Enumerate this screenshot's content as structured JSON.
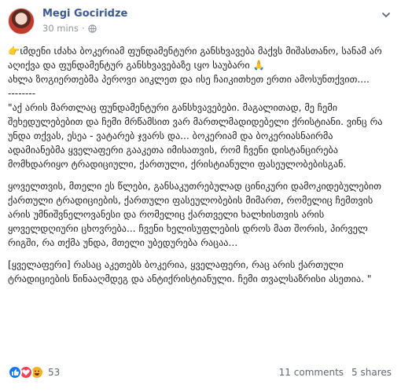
{
  "post": {
    "author": "Megi Gociridze",
    "time": "30 mins",
    "paragraphs": [
      "ιმდენი ιძახა ბოკერიამ ფუნდამენტური განსხვავება მაქვს მიშასთანო, სანამ არ აღიქვა და ფუნდამენტურ განსხვავებაზე ιყო საუბარი",
      "ახლა ზოგიერთებმა პეროვი აიკლეთ და ისე ჩაიკითხეთ ერთი ამოსუნთქვით....",
      "--------",
      "\"აქ არის მართლაც ფუნდამენტური განსხვავებები. მაგალითად, მე ჩემი შეხედულებებით და ჩემი მრწამსით ვარ მართლმადიდებელი ქრისტიანი. ვინც რა უნდა თქვას, ესეა - ვატარებ ჯვარს და... ბოკერიამ და ბოკერიასნაირმა ადამიანებმა ყველაფერი გააკეთა იმისათვის, რომ ჩვენი დისტანცირება მომხდარიყო ტრადიციული, ქართული, ქრისტიანული ფასეულობებისგან.",
      "ყოველთვის, მთელი ეს წლები, განსაკუთრებულად ცინიკური დამოკიდებულებით ქართული ტრადიციების, ქართული ფასეულობების მიმართ, რომელიც ჩემთვის არის უმნიშვნელოვანესი და რომელიც ქართველი ხალხისთვის არის ყოველდღიური ცხოვრება... ჩვენი ხელისუფლების დროს მათ შორის, პირველ რიგში, რა თქმა უნდა, მთელი უბედურება რაცაა...",
      "[ყველაფერი] რასაც აკეთებს ბოკერია, ყველაფერი, რაც არის ქართული ტრადიციების წინააღმდეგ და ანტიქრისტიანული. ჩემი თვალსაზრისი ასეთია. \""
    ],
    "emoji_start": "👉",
    "emoji_pray": "🙏"
  },
  "footer": {
    "reaction_count": "53",
    "comments": "11 comments",
    "shares": "5 shares"
  }
}
